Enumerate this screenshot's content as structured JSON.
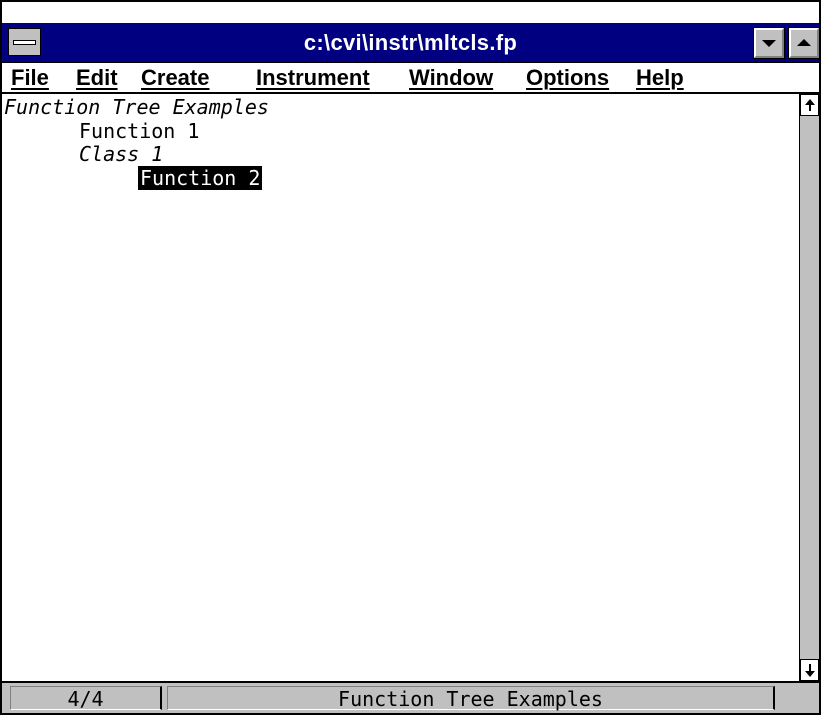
{
  "window": {
    "title": "c:\\cvi\\instr\\mltcls.fp"
  },
  "menu": {
    "file": "File",
    "edit": "Edit",
    "create": "Create",
    "instrument": "Instrument",
    "window": "Window",
    "options": "Options",
    "help": "Help"
  },
  "tree": {
    "root": "Function Tree Examples",
    "function_1": "Function 1",
    "class_1": "Class 1",
    "function_2": "Function 2",
    "selected": "Function 2"
  },
  "status": {
    "position": "4/4",
    "description": "Function Tree Examples"
  },
  "icons": {
    "system_menu": "system-menu-icon",
    "minimize": "chevron-down-icon",
    "maximize": "chevron-up-icon",
    "scroll_up": "arrow-up-icon",
    "scroll_down": "arrow-down-icon"
  },
  "colors": {
    "title_bar": "#000080",
    "chrome": "#c0c0c0",
    "selection": "#000000"
  }
}
